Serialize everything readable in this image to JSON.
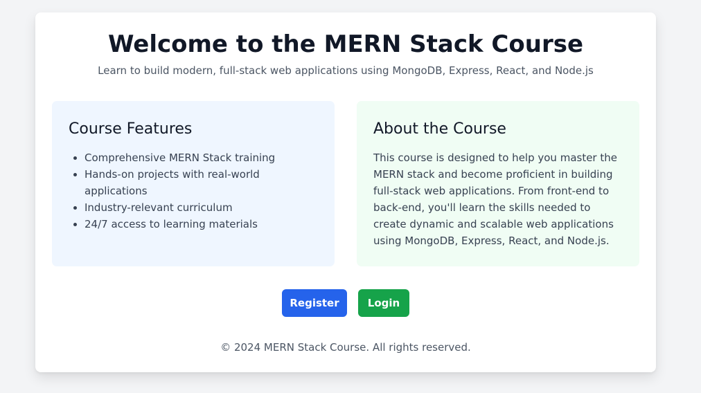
{
  "header": {
    "title": "Welcome to the MERN Stack Course",
    "subtitle": "Learn to build modern, full-stack web applications using MongoDB, Express, React, and Node.js"
  },
  "features": {
    "heading": "Course Features",
    "items": [
      "Comprehensive MERN Stack training",
      "Hands-on projects with real-world applications",
      "Industry-relevant curriculum",
      "24/7 access to learning materials"
    ]
  },
  "about": {
    "heading": "About the Course",
    "text": "This course is designed to help you master the MERN stack and become proficient in building full-stack web applications. From front-end to back-end, you'll learn the skills needed to create dynamic and scalable web applications using MongoDB, Express, React, and Node.js."
  },
  "actions": {
    "register_label": "Register",
    "login_label": "Login"
  },
  "footer": {
    "text": "© 2024 MERN Stack Course. All rights reserved."
  },
  "colors": {
    "background": "#f3f4f6",
    "features_panel": "#eff6ff",
    "about_panel": "#f0fdf4",
    "register_button": "#2563eb",
    "login_button": "#16a34a"
  }
}
